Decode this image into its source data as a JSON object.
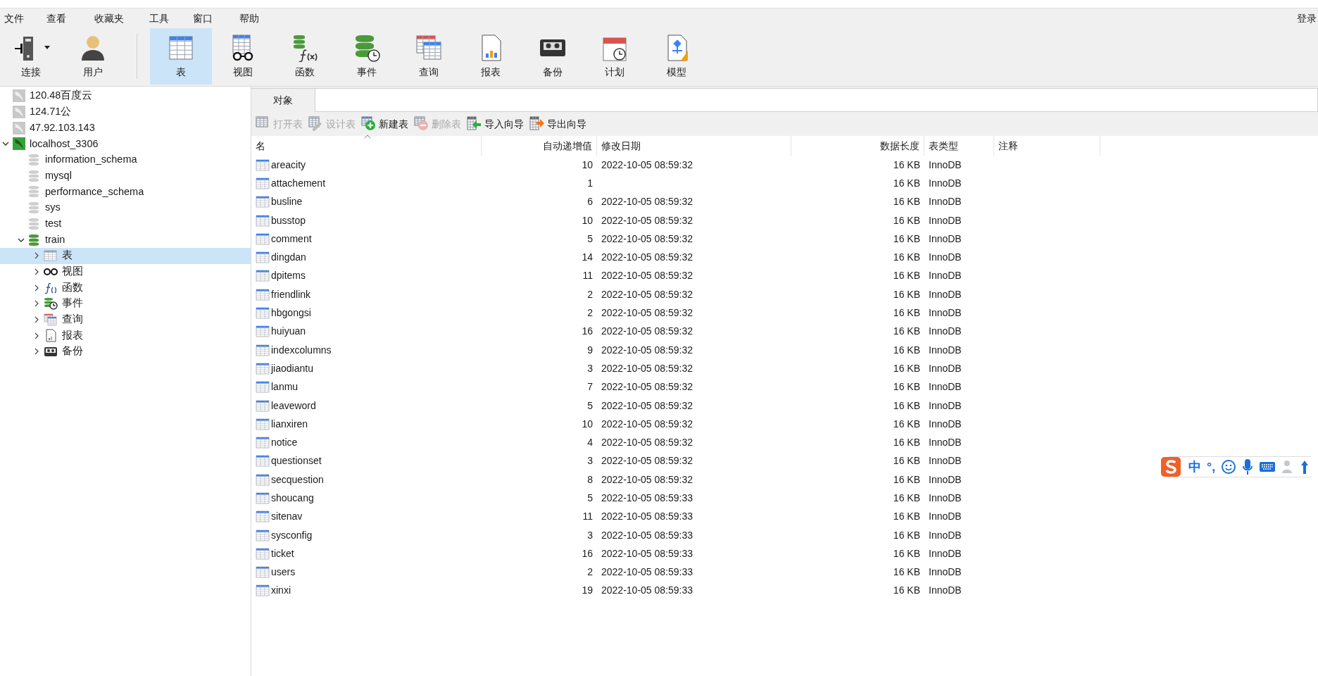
{
  "menu": [
    "文件",
    "查看",
    "收藏夹",
    "工具",
    "窗口",
    "帮助"
  ],
  "login": "登录",
  "toolbar": [
    {
      "label": "连接",
      "kind": "connect",
      "selected": false
    },
    {
      "label": "用户",
      "kind": "user",
      "selected": false
    },
    {
      "label": "表",
      "kind": "table",
      "selected": true
    },
    {
      "label": "视图",
      "kind": "view",
      "selected": false
    },
    {
      "label": "函数",
      "kind": "function",
      "selected": false
    },
    {
      "label": "事件",
      "kind": "event",
      "selected": false
    },
    {
      "label": "查询",
      "kind": "query",
      "selected": false
    },
    {
      "label": "报表",
      "kind": "report",
      "selected": false
    },
    {
      "label": "备份",
      "kind": "backup",
      "selected": false
    },
    {
      "label": "计划",
      "kind": "schedule",
      "selected": false
    },
    {
      "label": "模型",
      "kind": "model",
      "selected": false
    }
  ],
  "sidebar": {
    "items": [
      {
        "name": "120.48百度云",
        "kind": "connection",
        "connected": false
      },
      {
        "name": "124.71公",
        "kind": "connection",
        "connected": false
      },
      {
        "name": "47.92.103.143",
        "kind": "connection",
        "connected": false
      },
      {
        "name": "localhost_3306",
        "kind": "connection",
        "connected": true,
        "expanded": true,
        "children": [
          {
            "name": "information_schema",
            "kind": "database",
            "connected": false
          },
          {
            "name": "mysql",
            "kind": "database",
            "connected": false
          },
          {
            "name": "performance_schema",
            "kind": "database",
            "connected": false
          },
          {
            "name": "sys",
            "kind": "database",
            "connected": false
          },
          {
            "name": "test",
            "kind": "database",
            "connected": false
          },
          {
            "name": "train",
            "kind": "database",
            "connected": true,
            "expanded": true,
            "children": [
              {
                "name": "表",
                "kind": "table",
                "expanded": false,
                "selected": true
              },
              {
                "name": "视图",
                "kind": "view",
                "expanded": false,
                "selected": false
              },
              {
                "name": "函数",
                "kind": "function",
                "expanded": false,
                "selected": false
              },
              {
                "name": "事件",
                "kind": "event",
                "expanded": false,
                "selected": false
              },
              {
                "name": "查询",
                "kind": "query",
                "expanded": false,
                "selected": false
              },
              {
                "name": "报表",
                "kind": "report",
                "expanded": false,
                "selected": false
              },
              {
                "name": "备份",
                "kind": "backup",
                "expanded": false,
                "selected": false
              }
            ]
          }
        ]
      }
    ]
  },
  "tabs": [
    {
      "label": "对象",
      "selected": true
    }
  ],
  "actions": [
    {
      "label": "打开表",
      "kind": "open",
      "disabled": true
    },
    {
      "label": "设计表",
      "kind": "design",
      "disabled": true
    },
    {
      "label": "新建表",
      "kind": "new",
      "disabled": false
    },
    {
      "label": "删除表",
      "kind": "delete",
      "disabled": true
    },
    {
      "label": "导入向导",
      "kind": "import",
      "disabled": false
    },
    {
      "label": "导出向导",
      "kind": "export",
      "disabled": false
    }
  ],
  "table": {
    "columns": [
      "名",
      "自动递增值",
      "修改日期",
      "数据长度",
      "表类型",
      "注释"
    ],
    "rows": [
      [
        "areacity",
        "10",
        "2022-10-05 08:59:32",
        "16 KB",
        "InnoDB"
      ],
      [
        "attachement",
        "1",
        "",
        "16 KB",
        "InnoDB"
      ],
      [
        "busline",
        "6",
        "2022-10-05 08:59:32",
        "16 KB",
        "InnoDB"
      ],
      [
        "busstop",
        "10",
        "2022-10-05 08:59:32",
        "16 KB",
        "InnoDB"
      ],
      [
        "comment",
        "5",
        "2022-10-05 08:59:32",
        "16 KB",
        "InnoDB"
      ],
      [
        "dingdan",
        "14",
        "2022-10-05 08:59:32",
        "16 KB",
        "InnoDB"
      ],
      [
        "dpitems",
        "11",
        "2022-10-05 08:59:32",
        "16 KB",
        "InnoDB"
      ],
      [
        "friendlink",
        "2",
        "2022-10-05 08:59:32",
        "16 KB",
        "InnoDB"
      ],
      [
        "hbgongsi",
        "2",
        "2022-10-05 08:59:32",
        "16 KB",
        "InnoDB"
      ],
      [
        "huiyuan",
        "16",
        "2022-10-05 08:59:32",
        "16 KB",
        "InnoDB"
      ],
      [
        "indexcolumns",
        "9",
        "2022-10-05 08:59:32",
        "16 KB",
        "InnoDB"
      ],
      [
        "jiaodiantu",
        "3",
        "2022-10-05 08:59:32",
        "16 KB",
        "InnoDB"
      ],
      [
        "lanmu",
        "7",
        "2022-10-05 08:59:32",
        "16 KB",
        "InnoDB"
      ],
      [
        "leaveword",
        "5",
        "2022-10-05 08:59:32",
        "16 KB",
        "InnoDB"
      ],
      [
        "lianxiren",
        "10",
        "2022-10-05 08:59:32",
        "16 KB",
        "InnoDB"
      ],
      [
        "notice",
        "4",
        "2022-10-05 08:59:32",
        "16 KB",
        "InnoDB"
      ],
      [
        "questionset",
        "3",
        "2022-10-05 08:59:32",
        "16 KB",
        "InnoDB"
      ],
      [
        "secquestion",
        "8",
        "2022-10-05 08:59:32",
        "16 KB",
        "InnoDB"
      ],
      [
        "shoucang",
        "5",
        "2022-10-05 08:59:33",
        "16 KB",
        "InnoDB"
      ],
      [
        "sitenav",
        "11",
        "2022-10-05 08:59:33",
        "16 KB",
        "InnoDB"
      ],
      [
        "sysconfig",
        "3",
        "2022-10-05 08:59:33",
        "16 KB",
        "InnoDB"
      ],
      [
        "ticket",
        "16",
        "2022-10-05 08:59:33",
        "16 KB",
        "InnoDB"
      ],
      [
        "users",
        "2",
        "2022-10-05 08:59:33",
        "16 KB",
        "InnoDB"
      ],
      [
        "xinxi",
        "19",
        "2022-10-05 08:59:33",
        "16 KB",
        "InnoDB"
      ]
    ]
  },
  "ime_bar": [
    "中",
    "°,"
  ]
}
